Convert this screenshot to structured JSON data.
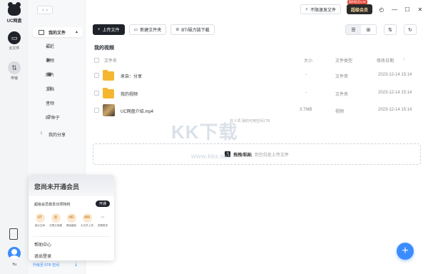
{
  "app": {
    "logo_text": "UC网盘"
  },
  "rail": {
    "cloud_label": "云文件",
    "transfer_label": "传输",
    "user_name": "Yu"
  },
  "sidebar": {
    "my_files": "我的文件",
    "items": [
      "最近",
      "视频",
      "图片",
      "文档",
      "音频",
      "BT种子"
    ],
    "my_share": "我的分享"
  },
  "titlebar": {
    "no_limit": "不限速发文件",
    "vip": "超级会员",
    "vip_promo": "限时低至0.80"
  },
  "toolbar": {
    "upload": "上传文件",
    "new_folder": "新建文件夹",
    "bt_download": "BT/磁力链下载"
  },
  "main": {
    "title": "我的视频",
    "columns": {
      "name": "文件名",
      "size": "大小",
      "type": "文件类型",
      "date": "修改日期"
    },
    "rows": [
      {
        "name": "来自：分享",
        "size": "-",
        "type": "文件夹",
        "date": "2023-12-14 15:14"
      },
      {
        "name": "我的视频",
        "size": "-",
        "type": "文件夹",
        "date": "2023-12-14 15:14"
      },
      {
        "name": "UC网盘介绍.mp4",
        "size": "3.7MB",
        "type": "视频",
        "date": "2023-12-14 15:14"
      }
    ],
    "count_text": "共 3 项  我的可用空间1TB",
    "drop_hint_bold": "拖拽/粘贴",
    "drop_hint": "到空白处上传文件"
  },
  "watermark": {
    "text": "KK下载",
    "url": "www.kkx.net"
  },
  "popup": {
    "title": "您尚未开通会员",
    "perk_line": "超级会员尊享32项特权",
    "open": "开通",
    "perks": [
      {
        "badge": "6T",
        "label": "超大空间"
      },
      {
        "badge": "云",
        "label": "无限云收藏"
      },
      {
        "badge": "HD",
        "label": "原画播放"
      },
      {
        "badge": "400",
        "label": "大文件上传"
      },
      {
        "badge": "···",
        "label": "查看更多"
      }
    ],
    "help": "帮助中心",
    "logout": "退出登录"
  },
  "storage": {
    "text": "升级至 6TB 空间"
  }
}
